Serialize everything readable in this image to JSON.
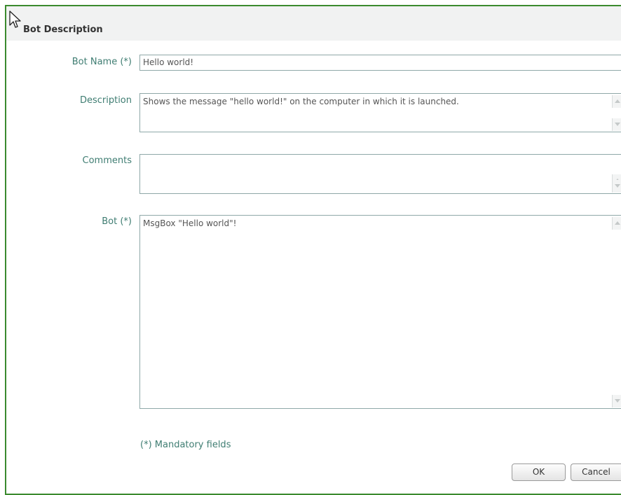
{
  "dialog": {
    "title": "Bot Description"
  },
  "form": {
    "bot_name_label": "Bot Name (*)",
    "bot_name_value": "Hello world!",
    "description_label": "Description",
    "description_value": "Shows the message \"hello world!\" on the computer in which it is launched.",
    "comments_label": "Comments",
    "comments_value": "",
    "bot_label": "Bot (*)",
    "bot_value": "MsgBox \"Hello world\"!"
  },
  "footer": {
    "mandatory_note": "(*) Mandatory fields",
    "ok_label": "OK",
    "cancel_label": "Cancel"
  },
  "icons": {
    "cursor": "mouse-pointer-icon",
    "scroll_up": "scroll-up-arrow-icon",
    "scroll_down": "scroll-down-arrow-icon"
  },
  "colors": {
    "border": "#3b8a2e",
    "label": "#3f7d72",
    "header_bg": "#f1f2f2"
  }
}
